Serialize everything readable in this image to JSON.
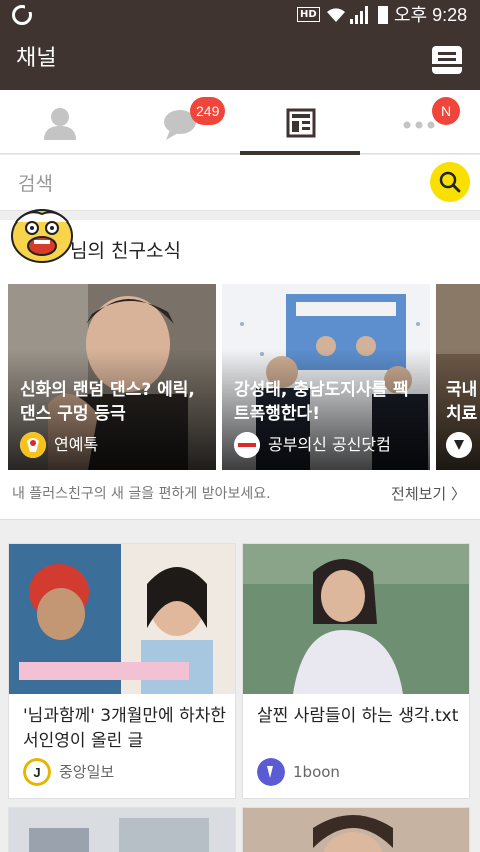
{
  "status_bar": {
    "hd": "HD",
    "time": "오후 9:28"
  },
  "header": {
    "title": "채널",
    "shop_icon": "channel-shop-icon"
  },
  "tabs": [
    {
      "name": "friends",
      "icon": "person-icon"
    },
    {
      "name": "chats",
      "icon": "chat-bubble-icon",
      "badge": "249"
    },
    {
      "name": "channel",
      "icon": "channel-icon",
      "active": true
    },
    {
      "name": "more",
      "icon": "more-dots-icon",
      "badge": "N"
    }
  ],
  "search": {
    "placeholder": "검색",
    "icon": "search-icon"
  },
  "friends_section": {
    "title": "님의 친구소식",
    "cards": [
      {
        "headline": "신화의 랜덤 댄스? 에릭, 댄스 구멍 등극",
        "source": "연예톡"
      },
      {
        "headline": "강성태, 충남도지사를 팩트폭행한다!",
        "source": "공부의신 공신닷컴"
      },
      {
        "headline": "국내 치료",
        "source": ""
      }
    ],
    "hint": "내 플러스친구의 새 글을 편하게 받아보세요.",
    "more_label": "전체보기 〉"
  },
  "feed": [
    {
      "title": "'님과함께' 3개월만에 하차한 서인영이 올린 글",
      "source": "중앙일보",
      "logo_letter": "J",
      "logo_color": "#e8b400"
    },
    {
      "title": "살찐 사람들이 하는 생각.txt",
      "source": "1boon",
      "logo_letter": "ǫ",
      "logo_color": "#5b5bd6"
    }
  ],
  "colors": {
    "brand_brown": "#3f3430",
    "badge_red": "#f0453a",
    "search_yellow": "#f9e000"
  }
}
